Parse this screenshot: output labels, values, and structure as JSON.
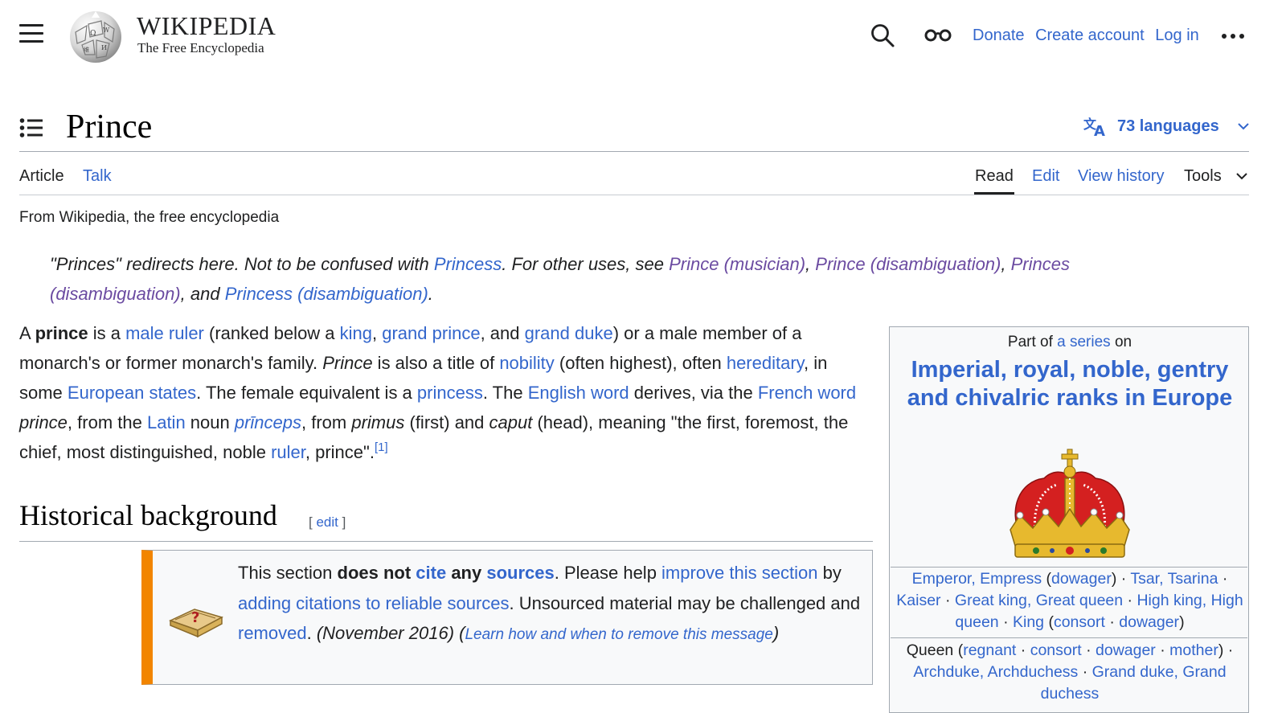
{
  "header": {
    "wordmark": "WIKIPEDIA",
    "tagline": "The Free Encyclopedia",
    "links": {
      "donate": "Donate",
      "create_account": "Create account",
      "login": "Log in"
    }
  },
  "title": {
    "text": "Prince",
    "languages": "73 languages"
  },
  "tabs": {
    "article": "Article",
    "talk": "Talk",
    "read": "Read",
    "edit": "Edit",
    "history": "View history",
    "tools": "Tools"
  },
  "from_line": "From Wikipedia, the free encyclopedia",
  "hatnote": {
    "t1": "\"Princes\" redirects here. Not to be confused with ",
    "l1": "Princess",
    "t2": ". For other uses, see ",
    "l2": "Prince (musician)",
    "t3": ", ",
    "l3": "Prince (disambiguation)",
    "t4": ", ",
    "l4": "Princes (disambiguation)",
    "t5": ", and ",
    "l5": "Princess (disambiguation)",
    "t6": "."
  },
  "lead": {
    "a": "A ",
    "b_prince": "prince",
    "c": " is a ",
    "l_male_ruler": "male ruler",
    "d": " (ranked below a ",
    "l_king": "king",
    "e": ", ",
    "l_grand_prince": "grand prince",
    "f": ", and ",
    "l_grand_duke": "grand duke",
    "g": ") or a male member of a monarch's or former monarch's family. ",
    "i_prince": "Prince",
    "h": " is also a title of ",
    "l_nobility": "nobility",
    "j": " (often highest), often ",
    "l_hereditary": "hereditary",
    "k": ", in some ",
    "l_european": "European states",
    "m": ". The female equivalent is a ",
    "l_princess": "princess",
    "n": ". The ",
    "l_english": "English word",
    "o": " derives, via the ",
    "l_french": "French word",
    "p": " ",
    "i_prince2": "prince",
    "q": ", from the ",
    "l_latin": "Latin",
    "r": " noun ",
    "l_princeps": "prīnceps",
    "s": ", from ",
    "i_primus": "primus",
    "t": " (first) and ",
    "i_caput": "caput",
    "u": " (head), meaning \"the first, foremost, the chief, most distinguished, noble ",
    "l_ruler": "ruler",
    "v": ", prince\".",
    "ref": "[1]"
  },
  "section": {
    "heading": "Historical background",
    "edit_open": "[ ",
    "edit": "edit",
    "edit_close": " ]"
  },
  "ambox": {
    "a": "This section ",
    "b1": "does not ",
    "l_cite": "cite",
    "b2": " any ",
    "l_sources": "sources",
    "c": ". Please help ",
    "l_improve": "improve this section",
    "d": " by ",
    "l_adding": "adding citations to reliable sources",
    "e": ". Unsourced material may be challenged and ",
    "l_removed": "removed",
    "f": ". ",
    "date": "(November 2016)",
    "g": " (",
    "l_learn": "Learn how and when to remove this message",
    "h": ")"
  },
  "infobox": {
    "part_a": "Part of ",
    "part_link": "a series",
    "part_b": " on",
    "title": "Imperial, royal, noble, gentry and chivalric ranks in Europe",
    "row1": {
      "emperor": "Emperor, Empress",
      "dowager": "dowager",
      "tsar": "Tsar, Tsarina",
      "kaiser": "Kaiser",
      "great_king": "Great king, Great queen",
      "high_king": "High king, High queen",
      "king": "King",
      "consort": "consort",
      "dowager2": "dowager"
    },
    "row2": {
      "queen": "Queen",
      "regnant": "regnant",
      "consort": "consort",
      "dowager": "dowager",
      "mother": "mother",
      "archduke": "Archduke, Archduchess",
      "grand_duke": "Grand duke, Grand duchess"
    }
  },
  "colors": {
    "link": "#3366cc",
    "visited": "#6b4ba1",
    "ambox_stripe": "#f28500",
    "infobox_bg": "#f8f9fa"
  },
  "icons": [
    "menu-icon",
    "wikipedia-globe-logo",
    "search-icon",
    "glasses-icon",
    "more-icon",
    "toc-icon",
    "translate-icon",
    "chevron-down-icon",
    "book-question-icon",
    "crown-image"
  ]
}
